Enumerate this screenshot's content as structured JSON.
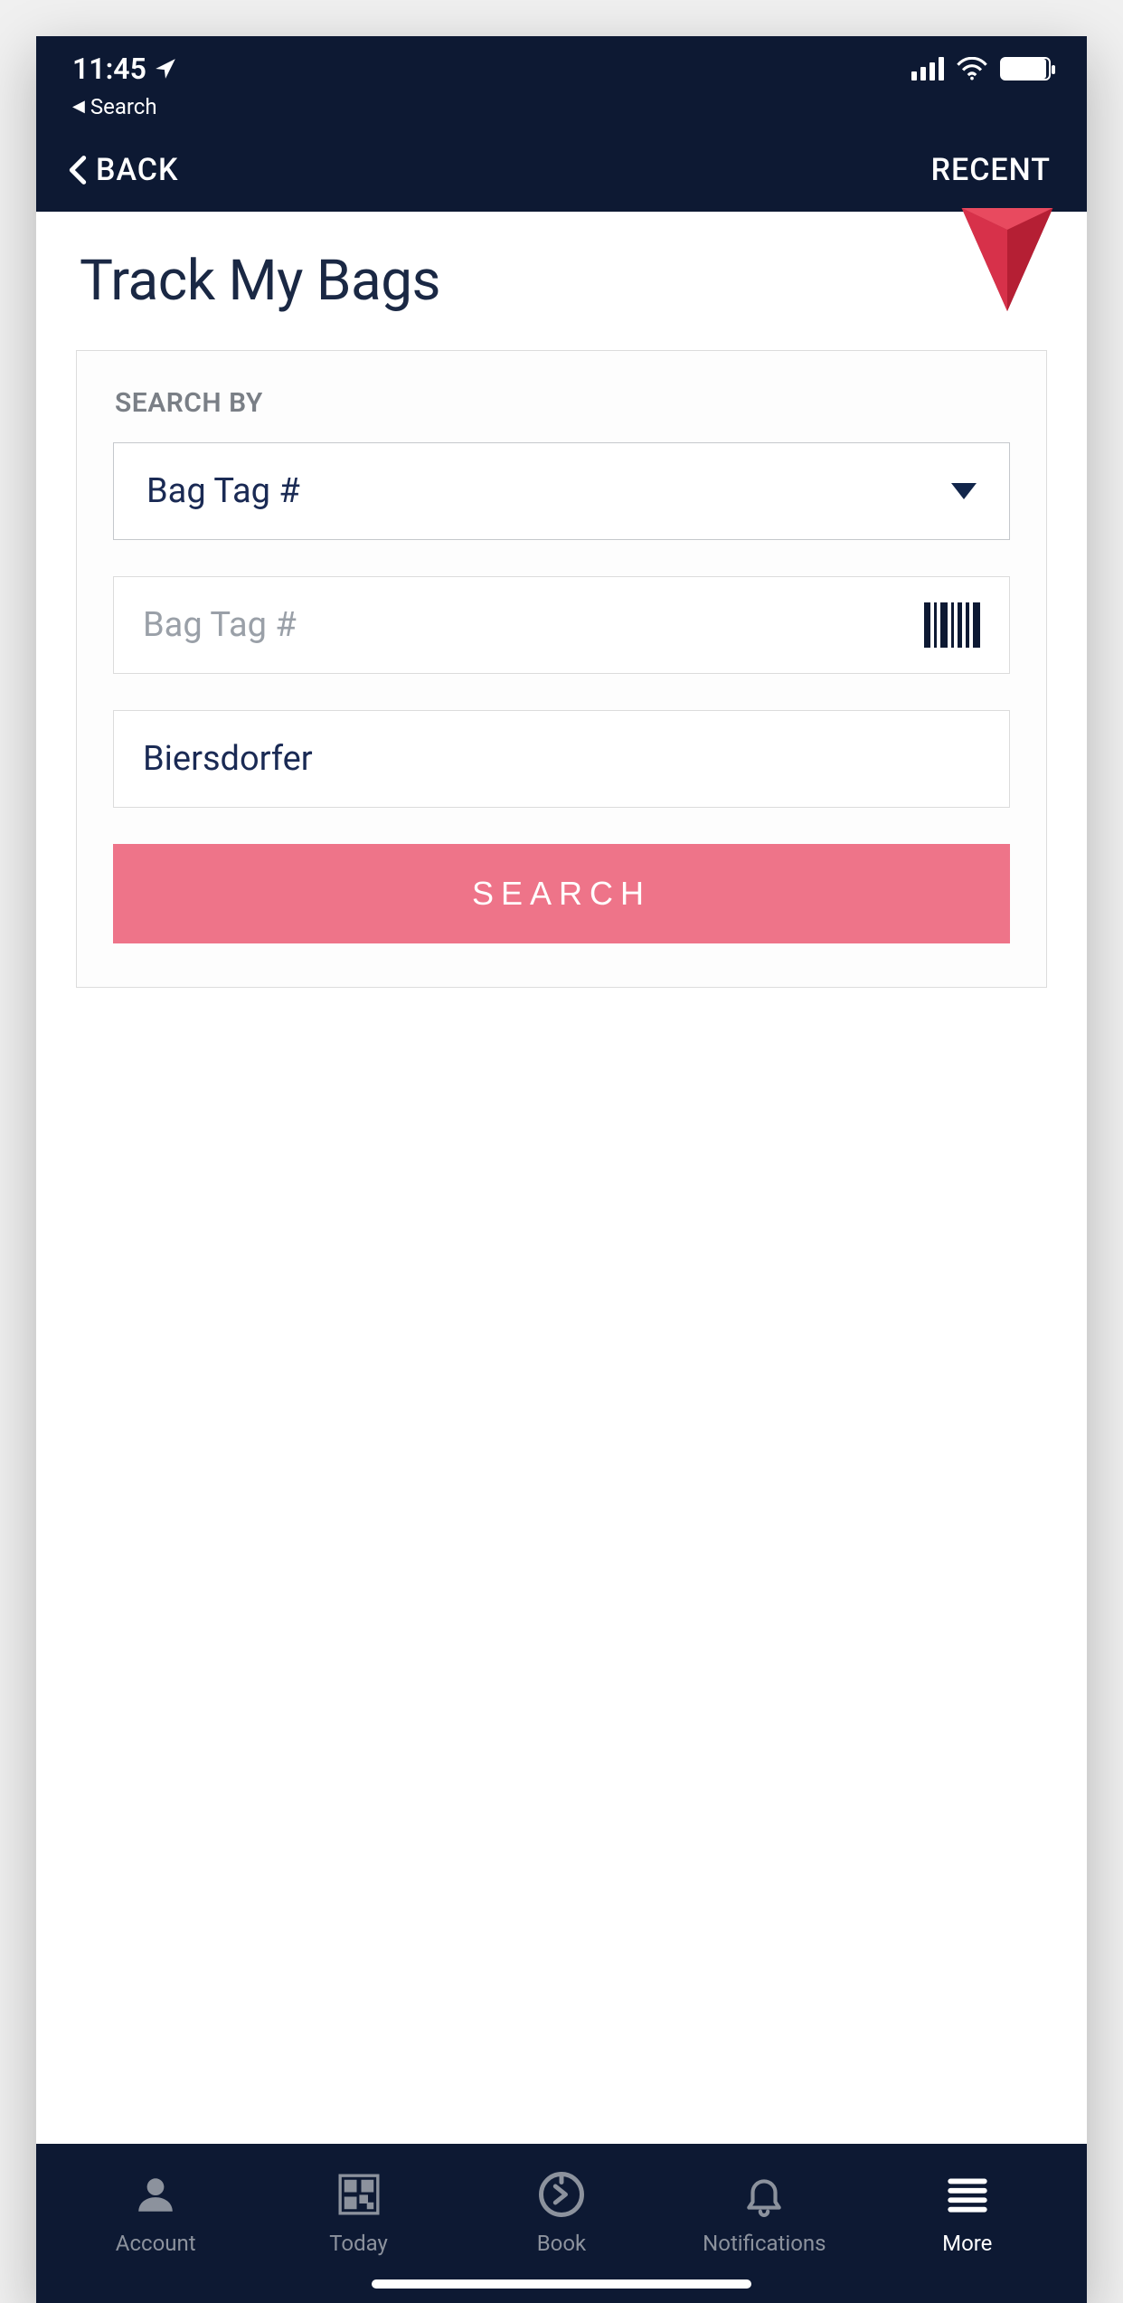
{
  "status": {
    "time": "11:45",
    "breadcrumb": "Search"
  },
  "navbar": {
    "back": "BACK",
    "recent": "RECENT"
  },
  "page": {
    "title": "Track My Bags"
  },
  "form": {
    "section_label": "SEARCH BY",
    "dropdown_value": "Bag Tag #",
    "tag_placeholder": "Bag Tag #",
    "tag_value": "",
    "lastname_value": "Biersdorfer",
    "search_button": "SEARCH"
  },
  "tabs": {
    "account": "Account",
    "today": "Today",
    "book": "Book",
    "notifications": "Notifications",
    "more": "More"
  }
}
